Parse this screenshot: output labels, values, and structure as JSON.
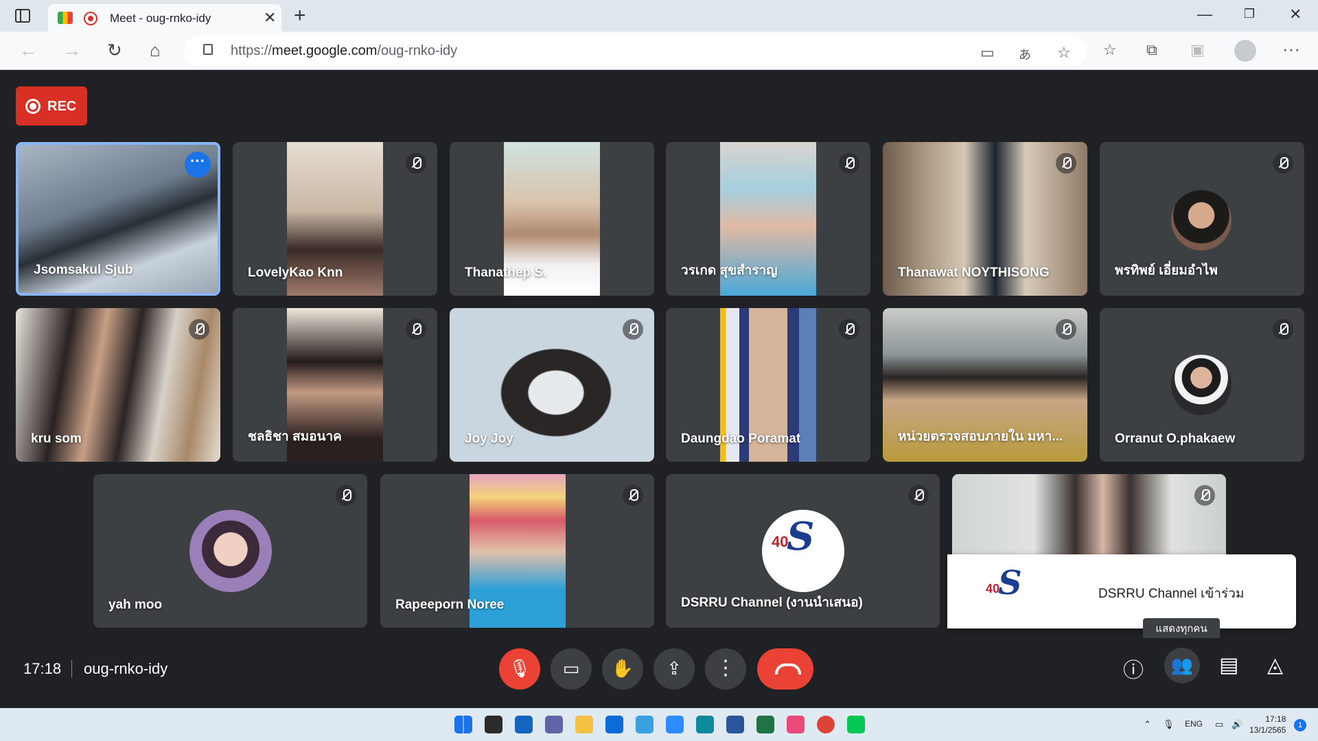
{
  "browser": {
    "tab_title": "Meet - oug-rnko-idy",
    "url_domain": "meet.google.com",
    "url_path": "/oug-rnko-idy",
    "url_scheme": "https://"
  },
  "rec_label": "REC",
  "participants": [
    {
      "name": "Jsomsakul Sjub",
      "selected": true,
      "has_more": true
    },
    {
      "name": "LovelyKao Knn",
      "muted": true
    },
    {
      "name": "Thanathep S."
    },
    {
      "name": "วรเกด สุขสำราญ",
      "muted": true
    },
    {
      "name": "Thanawat NOYTHISONG",
      "muted": true
    },
    {
      "name": "พรทิพย์ เอี่ยมอำไพ",
      "muted": true
    },
    {
      "name": "kru som",
      "muted": true
    },
    {
      "name": "ชลธิชา สมอนาค",
      "muted": true
    },
    {
      "name": "Joy Joy",
      "muted": true
    },
    {
      "name": "Daungdao Poramat",
      "muted": true
    },
    {
      "name": "หน่วยตรวจสอบภายใน มหา...",
      "muted": true
    },
    {
      "name": "Orranut O.phakaew",
      "muted": true
    },
    {
      "name": "yah moo",
      "muted": true
    },
    {
      "name": "Rapeeporn Noree",
      "muted": true
    },
    {
      "name": "DSRRU Channel (งานนำเสนอ)",
      "muted": true
    },
    {
      "name": "",
      "muted": true
    }
  ],
  "toast": {
    "text": "DSRRU Channel เข้าร่วม"
  },
  "tooltip": "แสดงทุกคน",
  "participant_count": "16",
  "bottom": {
    "time": "17:18",
    "meeting_code": "oug-rnko-idy"
  },
  "logo": {
    "number": "40",
    "letter": "S"
  },
  "taskbar": {
    "lang": "ENG",
    "time": "17:18",
    "date": "13/1/2565",
    "notif": "1"
  }
}
